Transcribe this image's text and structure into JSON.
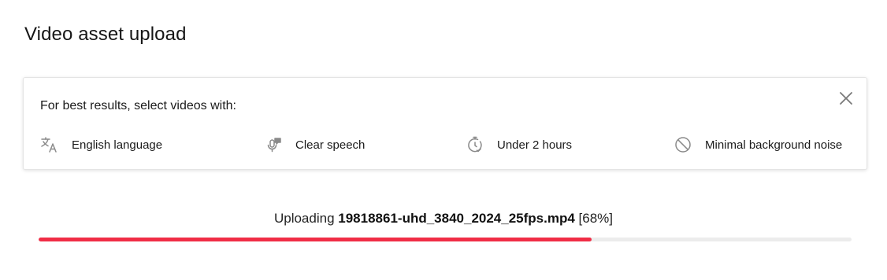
{
  "page": {
    "title": "Video asset upload"
  },
  "tips": {
    "heading": "For best results, select videos with:",
    "items": [
      {
        "label": "English language",
        "icon": "translate-icon"
      },
      {
        "label": "Clear speech",
        "icon": "voice-icon"
      },
      {
        "label": "Under 2 hours",
        "icon": "timer-icon"
      },
      {
        "label": "Minimal background noise",
        "icon": "no-noise-icon"
      }
    ],
    "close_icon": "close-icon"
  },
  "upload": {
    "prefix": "Uploading",
    "filename": "19818861-uhd_3840_2024_25fps.mp4",
    "percent_text": "[68%]",
    "progress": 0.68
  },
  "colors": {
    "accent": "#f02d46",
    "track": "#ececec",
    "icon": "#8a8a8a"
  }
}
